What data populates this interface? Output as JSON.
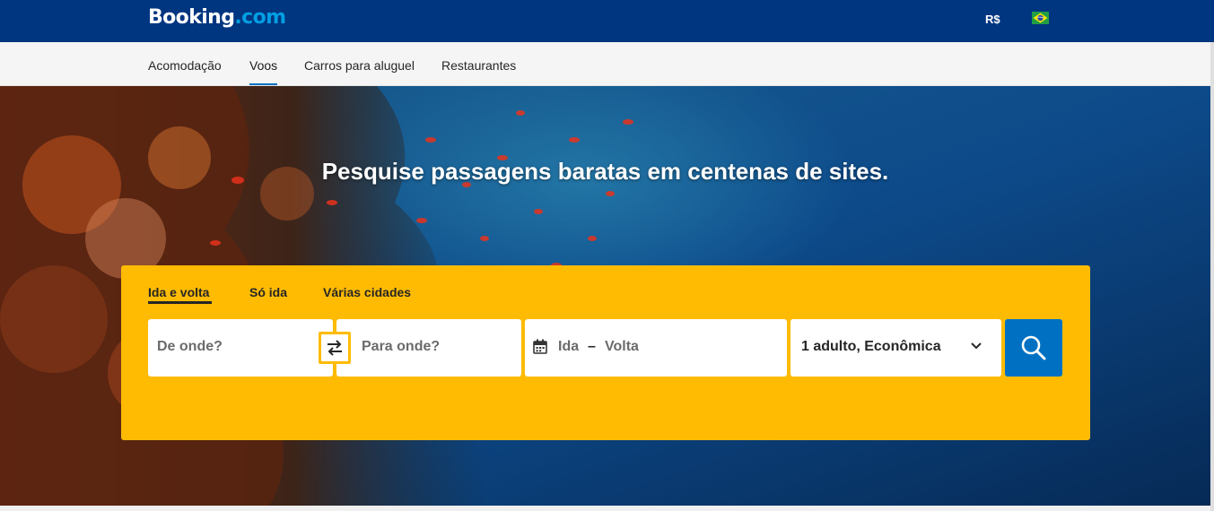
{
  "header": {
    "logo_main": "Booking",
    "logo_suffix": ".com",
    "currency": "R$",
    "language_flag_icon": "brazil-flag-icon"
  },
  "nav": {
    "items": [
      {
        "label": "Acomodação",
        "active": false
      },
      {
        "label": "Voos",
        "active": true
      },
      {
        "label": "Carros para aluguel",
        "active": false
      },
      {
        "label": "Restaurantes",
        "active": false
      }
    ]
  },
  "hero": {
    "title": "Pesquise passagens baratas em centenas de sites."
  },
  "search": {
    "trip_types": [
      {
        "label": "Ida e volta",
        "active": true
      },
      {
        "label": "Só ida",
        "active": false
      },
      {
        "label": "Várias cidades",
        "active": false
      }
    ],
    "origin_placeholder": "De onde?",
    "destination_placeholder": "Para onde?",
    "depart_label": "Ida",
    "date_separator": "–",
    "return_label": "Volta",
    "passengers": "1 adulto, Econômica",
    "icons": {
      "swap": "swap-arrows-icon",
      "calendar": "calendar-icon",
      "dropdown": "chevron-down-icon",
      "search": "search-icon"
    }
  },
  "colors": {
    "brand_blue": "#003580",
    "accent_yellow": "#febb02",
    "action_blue": "#0071c2",
    "logo_dot": "#009fe3"
  }
}
